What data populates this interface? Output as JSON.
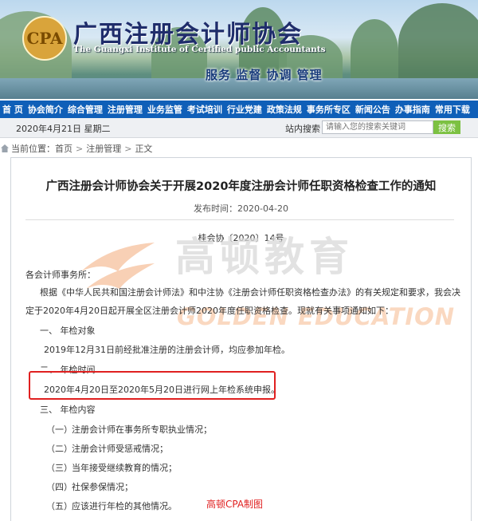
{
  "header": {
    "org_cn": "广西注册会计师协会",
    "org_en": "The Guangxi Institute of Certified public Accountants",
    "slogan": "服务 监督 协调 管理"
  },
  "nav": [
    "首 页",
    "协会简介",
    "综合管理",
    "注册管理",
    "业务监管",
    "考试培训",
    "行业党建",
    "政策法规",
    "事务所专区",
    "新闻公告",
    "办事指南",
    "常用下载"
  ],
  "topbar": {
    "date": "2020年4月21日 星期二",
    "search_label": "站内搜索",
    "search_placeholder": "请输入您的搜索关键词",
    "search_button": "搜索"
  },
  "breadcrumb": {
    "prefix": "当前位置：",
    "items": [
      "首页",
      "注册管理",
      "正文"
    ],
    "sep": ">"
  },
  "article": {
    "title": "广西注册会计师协会关于开展2020年度注册会计师任职资格检查工作的通知",
    "pubtime": "发布时间：2020-04-20",
    "doc_no": "桂会协〔2020〕14号",
    "salutation": "各会计师事务所：",
    "intro_1": "根据《中华人民共和国注册会计师法》和中注协《注册会计师任职资格检查办法》的有关规定和要求，我会决",
    "intro_2": "定于2020年4月20日起开展全区注册会计师2020年度任职资格检查。现就有关事项通知如下：",
    "s1_title": "一、  年检对象",
    "s1_body": "2019年12月31日前经批准注册的注册会计师，均应参加年检。",
    "s2_title": "二、  年检时间",
    "s2_body": "2020年4月20日至2020年5月20日进行网上年检系统申报。",
    "s3_title": "三、  年检内容",
    "items": [
      {
        "num": "（一）",
        "text": "注册会计师在事务所专职执业情况；"
      },
      {
        "num": "（二）",
        "text": "注册会计师受惩戒情况；"
      },
      {
        "num": "（三）",
        "text": "当年接受继续教育的情况；"
      },
      {
        "num": "（四）",
        "text": "社保参保情况；"
      },
      {
        "num": "（五）",
        "text": "应该进行年检的其他情况。"
      }
    ]
  },
  "watermark": {
    "cn": "高顿教育",
    "en": "GOLDEN EDUCATION",
    "credit": "高顿CPA制图"
  }
}
